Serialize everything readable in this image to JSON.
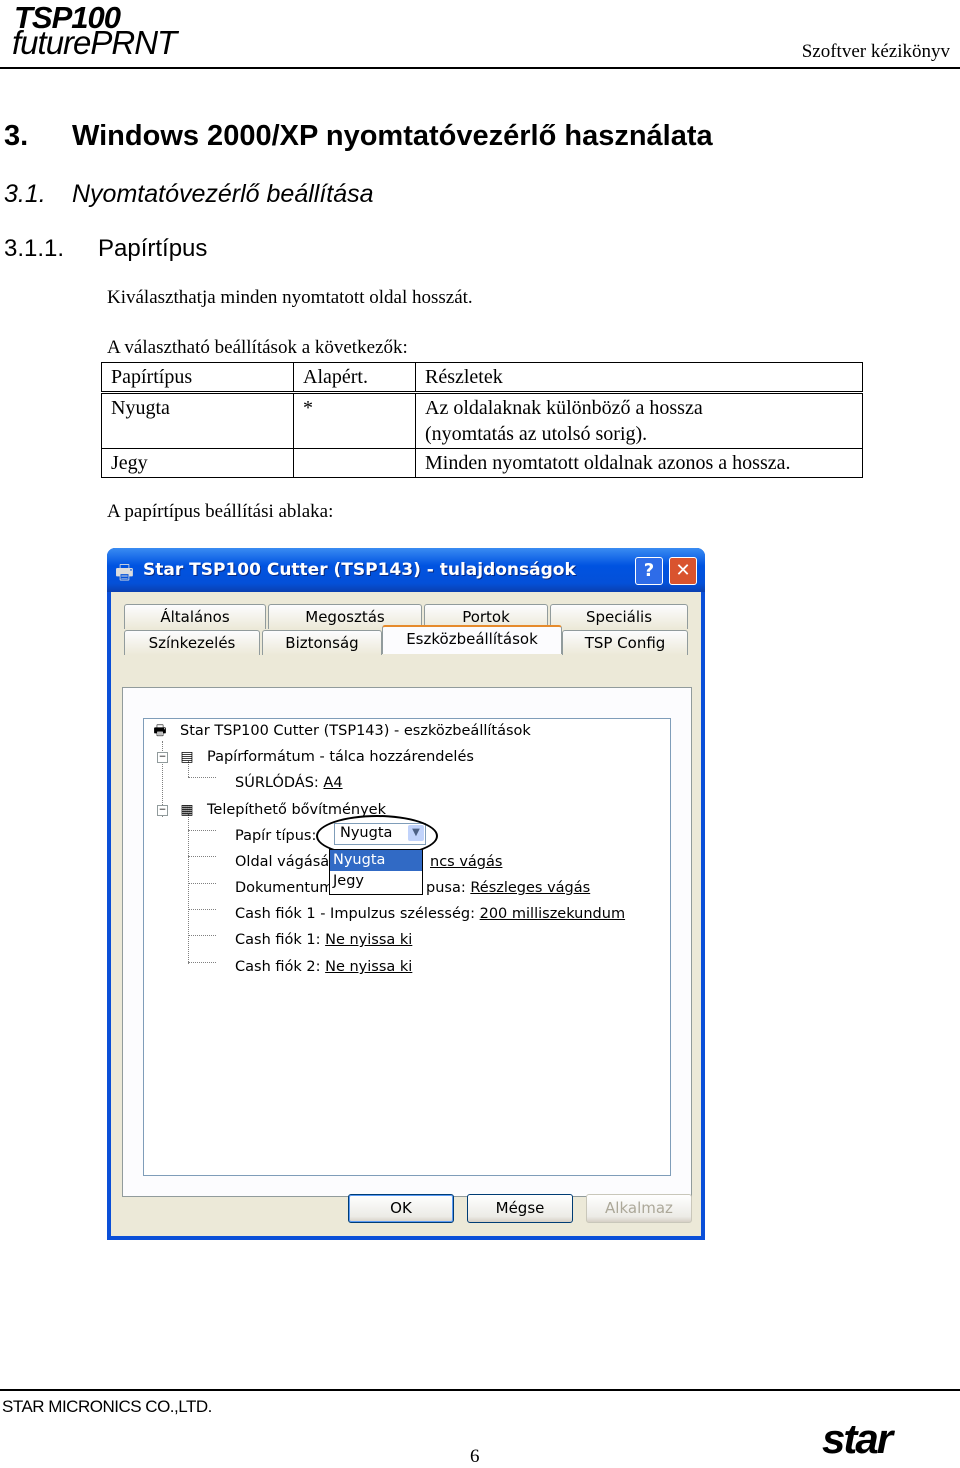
{
  "header": {
    "logo_line1": "TSP100",
    "logo_line2": "futurePRNT",
    "manual_title": "Szoftver kézikönyv"
  },
  "section": {
    "h1_num": "3.",
    "h1_text": "Windows 2000/XP nyomtatóvezérlő használata",
    "h2_num": "3.1.",
    "h2_text": "Nyomtatóvezérlő beállítása",
    "h3_num": "3.1.1.",
    "h3_text": "Papírtípus",
    "intro": "Kiválaszthatja minden nyomtatott oldal hosszát.",
    "options_intro": "A választható beállítások a következők:",
    "dialog_caption": "A papírtípus beállítási ablaka:"
  },
  "table": {
    "headers": [
      "Papírtípus",
      "Alapért.",
      "Részletek"
    ],
    "rows": [
      {
        "type": "Nyugta",
        "default": "*",
        "details_line1": "Az oldalaknak különböző a hossza",
        "details_line2": "(nyomtatás az utolsó sorig)."
      },
      {
        "type": "Jegy",
        "default": "",
        "details_line1": "Minden nyomtatott oldalnak azonos a hossza.",
        "details_line2": ""
      }
    ]
  },
  "dialog": {
    "title": "Star TSP100 Cutter (TSP143) - tulajdonságok",
    "help_button": "?",
    "close_button": "✕",
    "tabs_row1": [
      "Általános",
      "Megosztás",
      "Portok",
      "Speciális"
    ],
    "tabs_row2": [
      "Színkezelés",
      "Biztonság",
      "Eszközbeállítások",
      "TSP Config"
    ],
    "active_tab": "Eszközbeállítások",
    "tree": {
      "root": "Star TSP100 Cutter (TSP143) - eszközbeállítások",
      "group1": "Papírformátum - tálca hozzárendelés",
      "g1_item_label": "SÚRLÓDÁS:",
      "g1_item_value": "A4",
      "group2": "Telepíthető bővítmények",
      "paper_type_label": "Papír típus:",
      "paper_type_value": "Nyugta",
      "page_cut_label": "Oldal vágásár",
      "page_cut_value": "ncs vágás",
      "doc_cut_label": "Dokumentum",
      "doc_cut_mid": "pusa:",
      "doc_cut_value": "Részleges vágás",
      "cash_pulse_label": "Cash fiók 1 - Impulzus szélesség:",
      "cash_pulse_value": "200 milliszekundum",
      "cash1_label": "Cash fiók 1:",
      "cash1_value": "Ne nyissa ki",
      "cash2_label": "Cash fiók 2:",
      "cash2_value": "Ne nyissa ki"
    },
    "dropdown_options": [
      "Nyugta",
      "Jegy"
    ],
    "buttons": {
      "ok": "OK",
      "cancel": "Mégse",
      "apply": "Alkalmaz"
    }
  },
  "footer": {
    "company": "STAR MICRONICS CO.,LTD.",
    "page": "6",
    "logo": "star"
  },
  "colors": {
    "title_bar": "#0053e1",
    "dialog_face": "#ece9d8",
    "selection": "#316ac5",
    "close_button": "#d9532e"
  }
}
